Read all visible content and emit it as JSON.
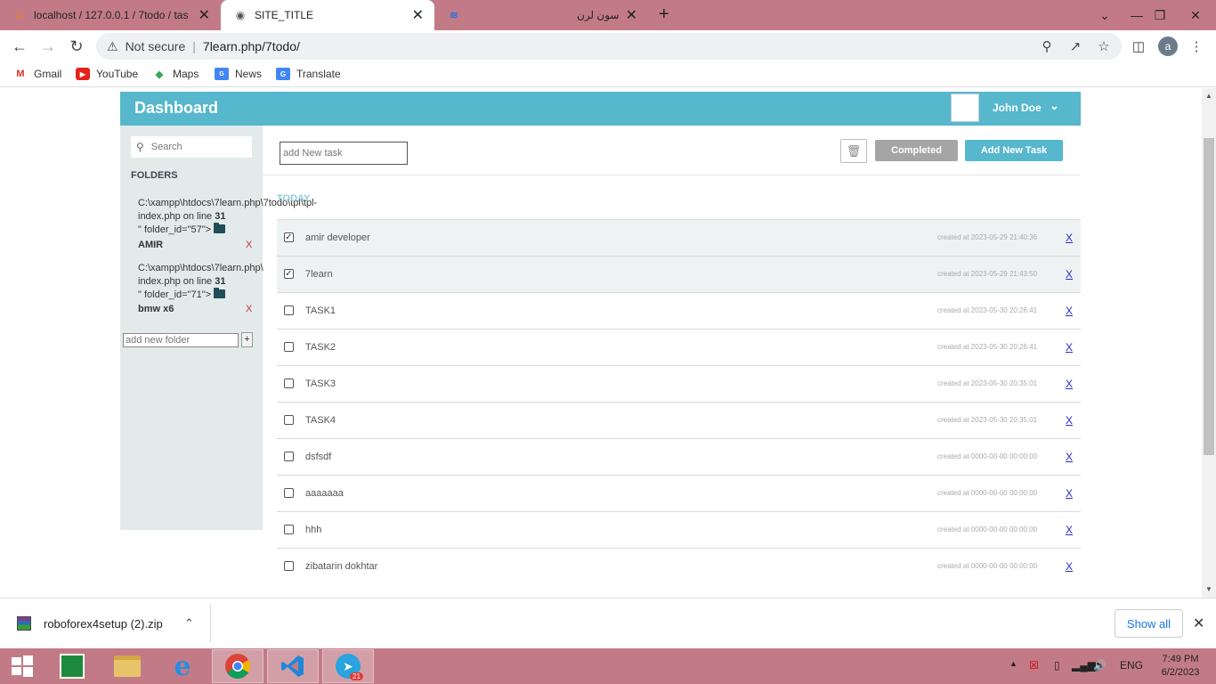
{
  "browser": {
    "tabs": [
      {
        "title": "localhost / 127.0.0.1 / 7todo / tas",
        "favicon": "phpmyadmin-icon"
      },
      {
        "title": "SITE_TITLE",
        "favicon": "globe-icon"
      },
      {
        "title": "سون لرن",
        "favicon": "sevenlearn-icon"
      }
    ],
    "not_secure": "Not secure",
    "url": "7learn.php/7todo/",
    "profile_initial": "a",
    "bookmarks": [
      "Gmail",
      "YouTube",
      "Maps",
      "News",
      "Translate"
    ]
  },
  "app": {
    "title": "Dashboard",
    "user_name": "John Doe",
    "search_placeholder": "Search",
    "folders_title": "FOLDERS",
    "folders": [
      {
        "line1": "C:\\xampp\\htdocs\\7learn.php\\7todo\\tpl\\tpl-",
        "line2a": "index.php on line ",
        "line2b": "31",
        "line3": "\" folder_id=\"57\">",
        "name": "AMIR",
        "remove": "X"
      },
      {
        "line1": "C:\\xampp\\htdocs\\7learn.php\\",
        "line2a": "index.php on line ",
        "line2b": "31",
        "line3": "\" folder_id=\"71\">",
        "name": "bmw x6",
        "remove": "X"
      }
    ],
    "new_folder_placeholder": "add new folder",
    "new_folder_button": "+",
    "new_task_placeholder": "add New task",
    "completed_label": "Completed",
    "add_task_label": "Add New Task",
    "section_title": "TODAY",
    "tasks": [
      {
        "name": "amir developer",
        "created": "created at 2023-05-29 21:40:36",
        "done": true,
        "remove": "X"
      },
      {
        "name": "7learn",
        "created": "created at 2023-05-29 21:43:50",
        "done": true,
        "remove": "X"
      },
      {
        "name": "TASK1",
        "created": "created at 2023-05-30 20:26:41",
        "done": false,
        "remove": "X"
      },
      {
        "name": "TASK2",
        "created": "created at 2023-05-30 20:26:41",
        "done": false,
        "remove": "X"
      },
      {
        "name": "TASK3",
        "created": "created at 2023-05-30 20:35:01",
        "done": false,
        "remove": "X"
      },
      {
        "name": "TASK4",
        "created": "created at 2023-05-30 20:35:01",
        "done": false,
        "remove": "X"
      },
      {
        "name": "dsfsdf",
        "created": "created at 0000-00-00 00:00:00",
        "done": false,
        "remove": "X"
      },
      {
        "name": "aaaaaaa",
        "created": "created at 0000-00-00 00:00:00",
        "done": false,
        "remove": "X"
      },
      {
        "name": "hhh",
        "created": "created at 0000-00-00 00:00:00",
        "done": false,
        "remove": "X"
      },
      {
        "name": "zibatarin dokhtar",
        "created": "created at 0000-00-00 00:00:00",
        "done": false,
        "remove": "X"
      }
    ]
  },
  "download": {
    "file": "roboforex4setup (2).zip",
    "show_all": "Show all"
  },
  "taskbar": {
    "language": "ENG",
    "time": "7:49 PM",
    "date": "6/2/2023",
    "telegram_badge": "21"
  },
  "colors": {
    "accent": "#56b7cd",
    "tabstrip": "#c27b86"
  }
}
